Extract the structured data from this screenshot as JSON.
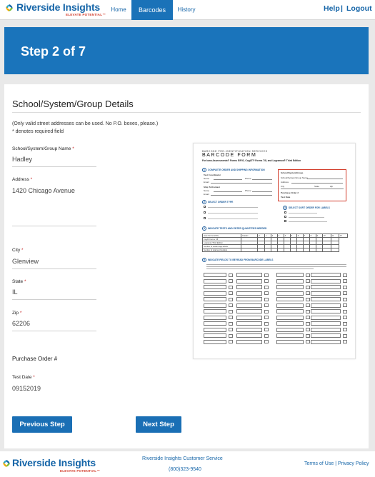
{
  "brand": {
    "name": "Riverside Insights",
    "tagline": "ELEVATE POTENTIAL™"
  },
  "nav": {
    "tabs": [
      {
        "label": "Home"
      },
      {
        "label": "Barcodes"
      },
      {
        "label": "History"
      }
    ],
    "active_tab": "Barcodes",
    "help": "Help",
    "separator": "|",
    "logout": "Logout"
  },
  "banner": {
    "title": "Step 2 of 7"
  },
  "section": {
    "title": "School/System/Group Details",
    "note": "(Only valid street addresses can be used. No P.O. boxes, please.)",
    "required_note": "* denotes required field"
  },
  "fields": {
    "name": {
      "label": "School/System/Group Name",
      "required": "*",
      "value": "Hadley"
    },
    "address": {
      "label": "Address",
      "required": "*",
      "value": "1420 Chicago Avenue"
    },
    "city": {
      "label": "City",
      "required": "*",
      "value": "Glenview"
    },
    "state": {
      "label": "State",
      "required": "*",
      "value": "IL"
    },
    "zip": {
      "label": "Zip",
      "required": "*",
      "value": "62206"
    },
    "purchase_order": {
      "label": "Purchase Order #"
    },
    "test_date": {
      "label": "Test Date",
      "required": "*",
      "value": "09152019"
    }
  },
  "buttons": {
    "previous": "Previous Step",
    "next": "Next Step"
  },
  "form_image": {
    "pre_title": "BARCODE PRE-IDENTIFICATION SERVICES",
    "title": "BARCODE FORM",
    "subtitle": "For Iowa Assessments® Forms E/F/G, CogAT® Forms 7/8, and Logramos® Third Edition",
    "sections": [
      {
        "num": "1",
        "label": "COMPLETE ORDER AND SHIPPING INFORMATION"
      },
      {
        "num": "2",
        "label": "SELECT ORDER TYPE"
      },
      {
        "num": "3",
        "label": "SELECT SORT ORDER FOR LABELS"
      },
      {
        "num": "4",
        "label": "INDICATE TESTS AND ENTER QUANTITIES NEEDED"
      },
      {
        "num": "5",
        "label": "INDICATE FIELDS TO BE READ FROM BARCODE LABELS"
      }
    ],
    "red_box_lines": [
      "School/System/Group",
      "School/System/Group Name",
      "Address",
      "City",
      "State",
      "Zip",
      "Purchase Order #",
      "Test Date"
    ],
    "left_lines": [
      "Test Coordinator",
      "Name",
      "Phone",
      "Email",
      "Ship To/Contact",
      "Name",
      "Phone",
      "Email"
    ],
    "grade_header": [
      "Grades",
      "K",
      "1",
      "2",
      "3",
      "4",
      "5",
      "6",
      "7",
      "8",
      "9",
      "10",
      "11",
      "12"
    ],
    "test_rows": [
      "Iowa Forms E/F/G",
      "CogAT Forms 7/8",
      "Logramos Third Edition",
      "Number of student age labels",
      "Number of total test booklets"
    ]
  },
  "footer": {
    "service": "Riverside Insights Customer Service",
    "phone": "(800)323-9540",
    "terms": "Terms of Use",
    "divider": "|",
    "privacy": "Privacy Policy"
  }
}
